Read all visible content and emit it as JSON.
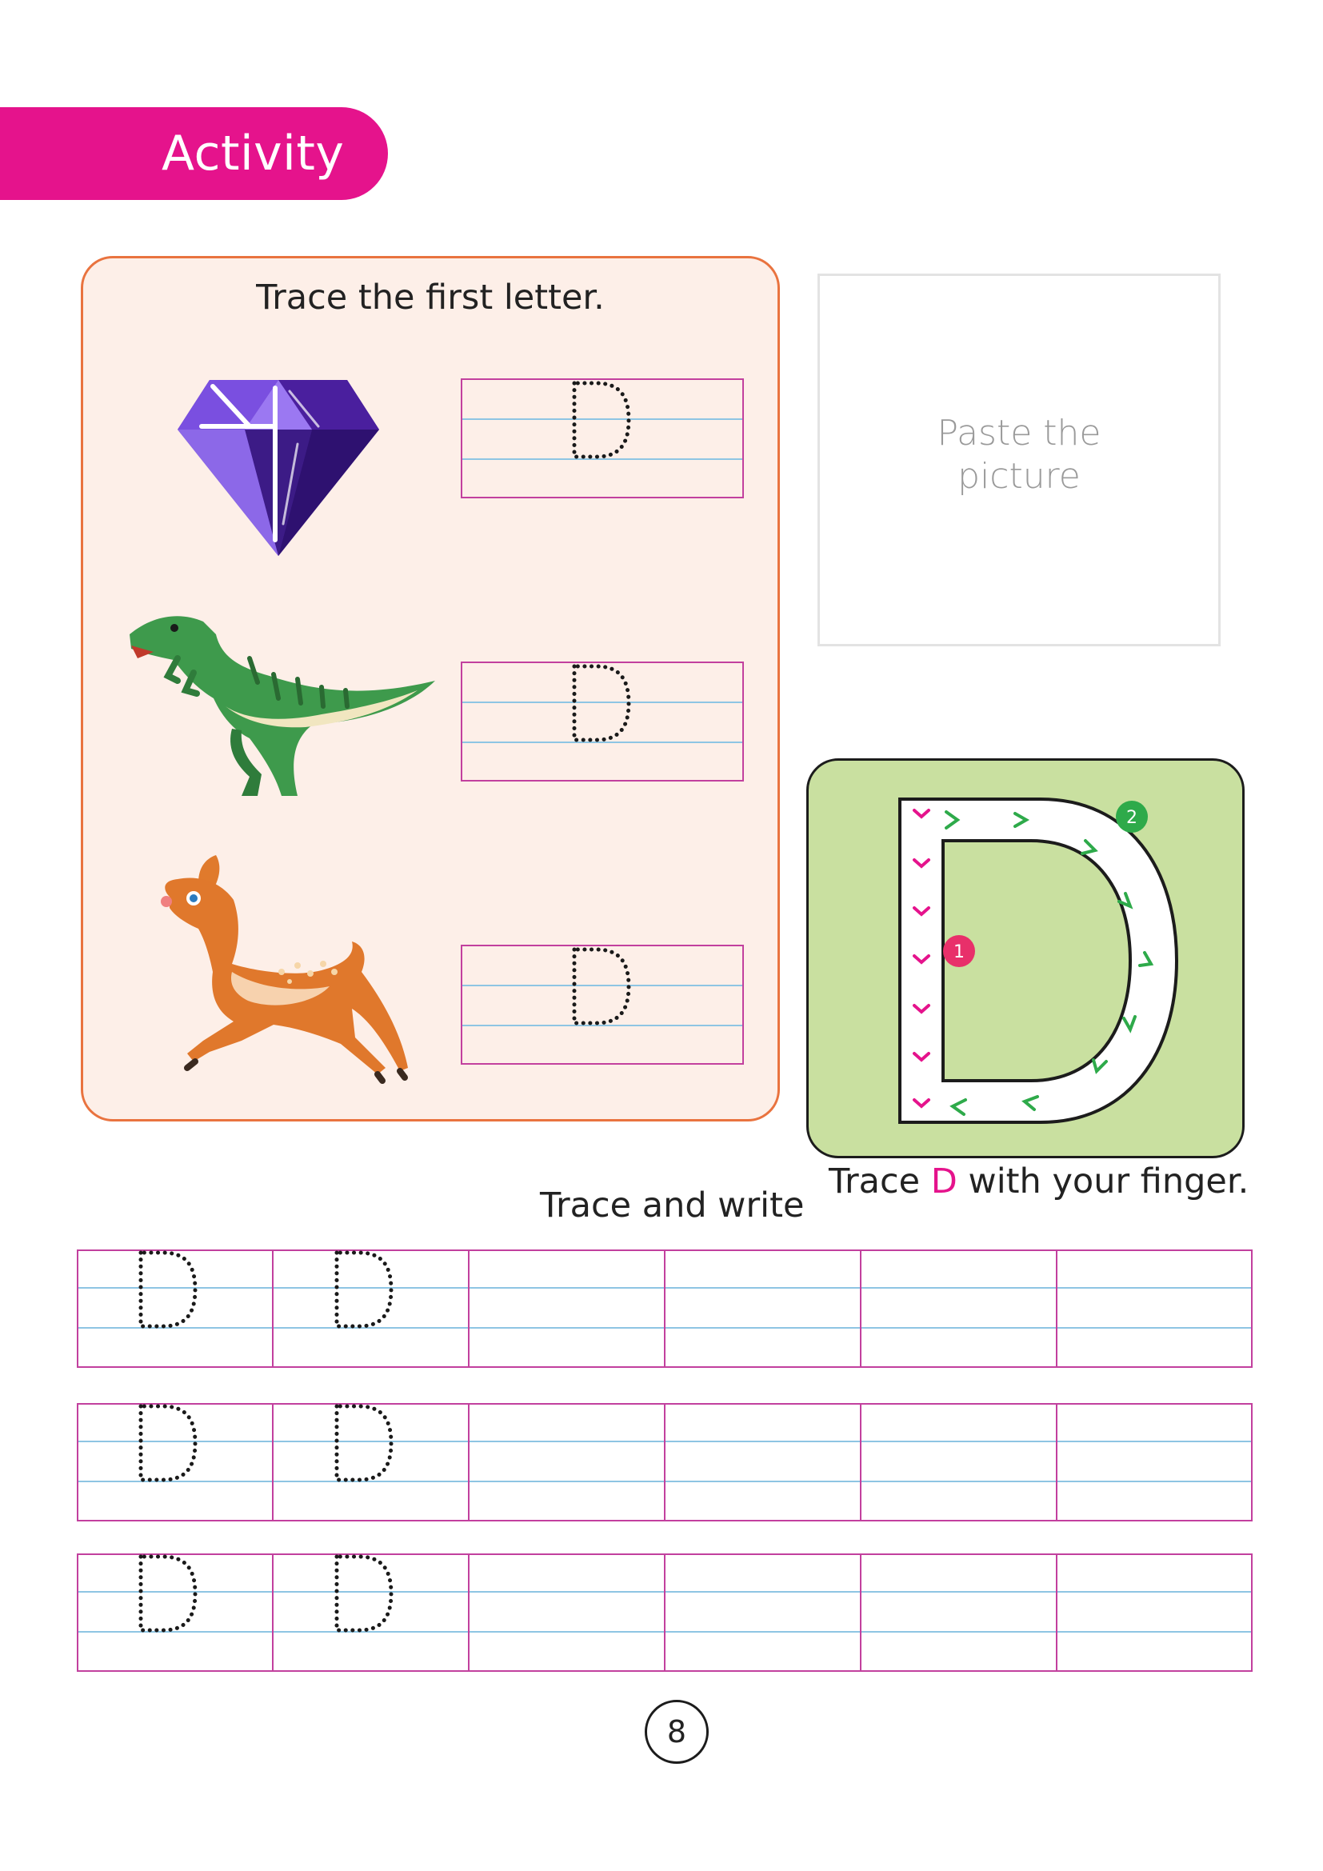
{
  "header": {
    "activity_label": "Activity"
  },
  "trace_first_letter": {
    "title": "Trace the first letter.",
    "items": [
      {
        "picture": "diamond",
        "letter": "D"
      },
      {
        "picture": "dinosaur",
        "letter": "D"
      },
      {
        "picture": "deer",
        "letter": "D"
      }
    ]
  },
  "paste_box": {
    "line1": "Paste the",
    "line2": "picture"
  },
  "finger_trace": {
    "letter": "D",
    "caption_before": "Trace ",
    "caption_letter": "D",
    "caption_after": " with your finger.",
    "step_1": "1",
    "step_2": "2"
  },
  "trace_and_write": {
    "title": "Trace and write",
    "letter": "D",
    "rows": 3,
    "traced_cells_per_row": 2,
    "blank_cells_per_row": 4
  },
  "footer": {
    "page_number": "8"
  },
  "colors": {
    "accent_pink": "#e5138c",
    "panel_orange_border": "#e9733f",
    "panel_peach": "#fdefe8",
    "finger_panel_green": "#c9e0a0",
    "guide_line_blue": "#8ec5e3",
    "guide_border_magenta": "#c2409e"
  }
}
